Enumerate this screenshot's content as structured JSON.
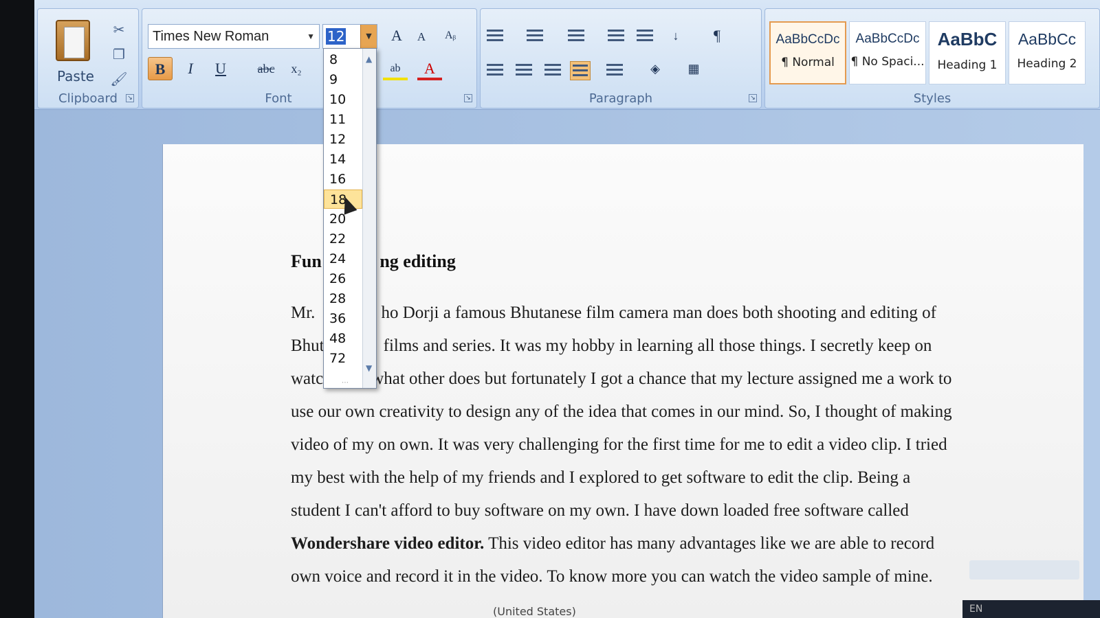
{
  "ribbon": {
    "clipboard": {
      "label": "Clipboard",
      "paste_label": "Paste"
    },
    "font": {
      "label": "Font",
      "font_name": "Times New Roman",
      "font_size": "12",
      "bold": "B",
      "italic": "I",
      "underline": "U",
      "strike": "abc",
      "subscript": "x₂",
      "grow": "A",
      "shrink": "A",
      "color_glyph": "A"
    },
    "paragraph": {
      "label": "Paragraph"
    },
    "styles": {
      "label": "Styles",
      "tiles": [
        {
          "sample": "AaBbCcDc",
          "name": "¶ Normal"
        },
        {
          "sample": "AaBbCcDc",
          "name": "¶ No Spaci..."
        },
        {
          "sample": "AaBbC",
          "name": "Heading 1"
        },
        {
          "sample": "AaBbCc",
          "name": "Heading 2"
        }
      ]
    }
  },
  "font_size_dropdown": {
    "options": [
      "8",
      "9",
      "10",
      "11",
      "12",
      "14",
      "16",
      "18",
      "20",
      "22",
      "24",
      "26",
      "28",
      "36",
      "48",
      "72"
    ],
    "hovered": "18"
  },
  "document": {
    "heading_left": "Fun",
    "heading_right": "ng editing",
    "lines": [
      {
        "left": "Mr.",
        "right": "ho Dorji a famous Bhutanese film camera man does both shooting and editing of"
      },
      {
        "left": "Bhut",
        "right": "films and series. It was my hobby in learning all those things. I secretly keep on"
      },
      {
        "left": "watc",
        "right": "what other does but fortunately I got a chance that my lecture assigned me a work to"
      },
      {
        "left": "",
        "right": "use our own creativity to design any of the idea that comes in our mind. So, I thought of making"
      },
      {
        "left": "",
        "right": "video of my on own. It was very challenging for the first time for me to edit a video clip. I tried"
      },
      {
        "left": "",
        "right": "my best with the help of my friends and I explored to get software to edit the clip. Being a"
      },
      {
        "left": "",
        "right": "student I can't afford to buy software on my own. I have down loaded free software called"
      },
      {
        "left": "",
        "bold": "Wondershare video editor.",
        "right": " This video editor has many advantages like we are able to record"
      },
      {
        "left": "",
        "right": "own voice and record it in the video. To know more you can watch the video sample of mine."
      }
    ],
    "status_language": "(United States)"
  },
  "tray": {
    "lang": "EN"
  }
}
